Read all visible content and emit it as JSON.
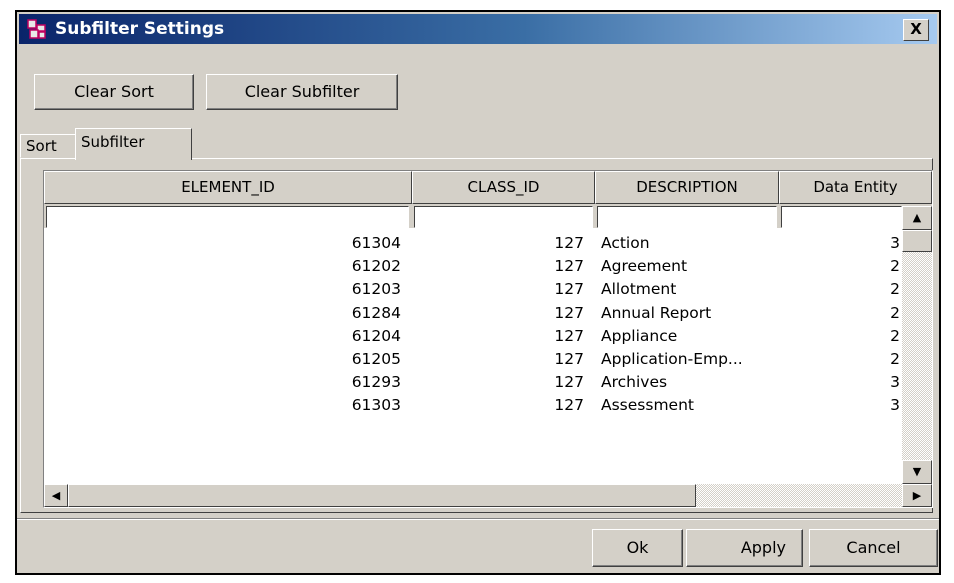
{
  "window": {
    "title": "Subfilter Settings",
    "close_label": "X"
  },
  "toolbar": {
    "clear_sort": "Clear Sort",
    "clear_subfilter": "Clear Subfilter"
  },
  "tabs": [
    {
      "label": "Sort",
      "active": false
    },
    {
      "label": "Subfilter",
      "active": true
    }
  ],
  "table": {
    "columns": [
      "ELEMENT_ID",
      "CLASS_ID",
      "DESCRIPTION",
      "Data Entity"
    ],
    "filters": [
      "",
      "",
      "",
      ""
    ],
    "rows": [
      {
        "element_id": "61304",
        "class_id": "127",
        "description": "Action",
        "data_entity": "3"
      },
      {
        "element_id": "61202",
        "class_id": "127",
        "description": "Agreement",
        "data_entity": "2"
      },
      {
        "element_id": "61203",
        "class_id": "127",
        "description": "Allotment",
        "data_entity": "2"
      },
      {
        "element_id": "61284",
        "class_id": "127",
        "description": "Annual Report",
        "data_entity": "2"
      },
      {
        "element_id": "61204",
        "class_id": "127",
        "description": "Appliance",
        "data_entity": "2"
      },
      {
        "element_id": "61205",
        "class_id": "127",
        "description": "Application-Emp...",
        "data_entity": "2"
      },
      {
        "element_id": "61293",
        "class_id": "127",
        "description": "Archives",
        "data_entity": "3"
      },
      {
        "element_id": "61303",
        "class_id": "127",
        "description": "Assessment",
        "data_entity": "3"
      }
    ]
  },
  "footer": {
    "ok": "Ok",
    "apply": "Apply",
    "cancel": "Cancel"
  },
  "icons": {
    "app": "subfilter-app-icon",
    "close": "close-icon",
    "up": "arrow-up-icon",
    "down": "arrow-down-icon",
    "left": "arrow-left-icon",
    "right": "arrow-right-icon"
  },
  "colors": {
    "titlebar_start": "#0a246a",
    "titlebar_end": "#a6caf0",
    "face": "#d4d0c8"
  }
}
